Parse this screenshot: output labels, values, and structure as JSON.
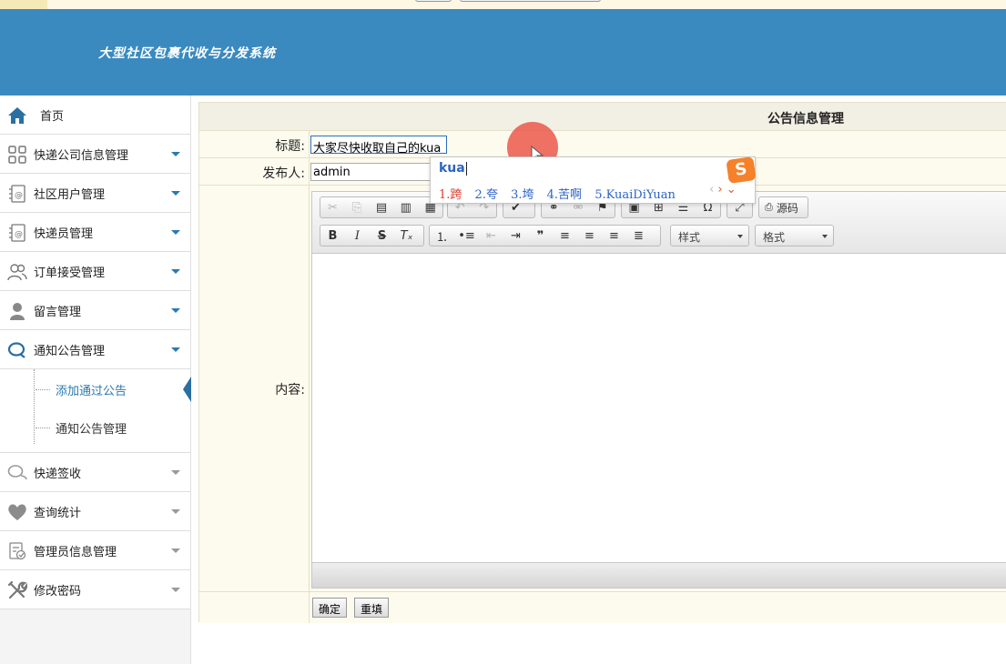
{
  "header": {
    "title": "大型社区包裹代收与分发系统"
  },
  "sidebar": {
    "items": [
      {
        "label": "首页",
        "icon": "home-icon",
        "expanded": false
      },
      {
        "label": "快递公司信息管理",
        "icon": "grid-icon"
      },
      {
        "label": "社区用户管理",
        "icon": "contacts-icon"
      },
      {
        "label": "快递员管理",
        "icon": "contacts-icon"
      },
      {
        "label": "订单接受管理",
        "icon": "users-icon"
      },
      {
        "label": "留言管理",
        "icon": "user-icon"
      },
      {
        "label": "通知公告管理",
        "icon": "chat-icon",
        "expanded": true
      }
    ],
    "submenu": [
      {
        "label": "添加通过公告",
        "active": true
      },
      {
        "label": "通知公告管理",
        "active": false
      }
    ],
    "items_after": [
      {
        "label": "快递签收",
        "icon": "chat-icon"
      },
      {
        "label": "查询统计",
        "icon": "heart-icon"
      },
      {
        "label": "管理员信息管理",
        "icon": "admin-icon"
      },
      {
        "label": "修改密码",
        "icon": "tools-icon"
      }
    ]
  },
  "main": {
    "title": "公告信息管理",
    "form": {
      "title_label": "标题:",
      "title_value": "大家尽快收取自己的kua",
      "publisher_label": "发布人:",
      "publisher_value": "admin",
      "content_label": "内容:"
    },
    "editor": {
      "source_label": "源码",
      "style_label": "样式",
      "format_label": "格式"
    },
    "buttons": {
      "submit": "确定",
      "reset": "重填"
    }
  },
  "ime": {
    "composition": "kua",
    "candidates": [
      "1.跨",
      "2.夸",
      "3.垮",
      "4.苦啊",
      "5.KuaiDiYuan"
    ],
    "brand_glyph": "S"
  },
  "colors": {
    "header": "#3a8ac0",
    "accent": "#2a7ab0",
    "form_bg": "#fdfbee"
  }
}
